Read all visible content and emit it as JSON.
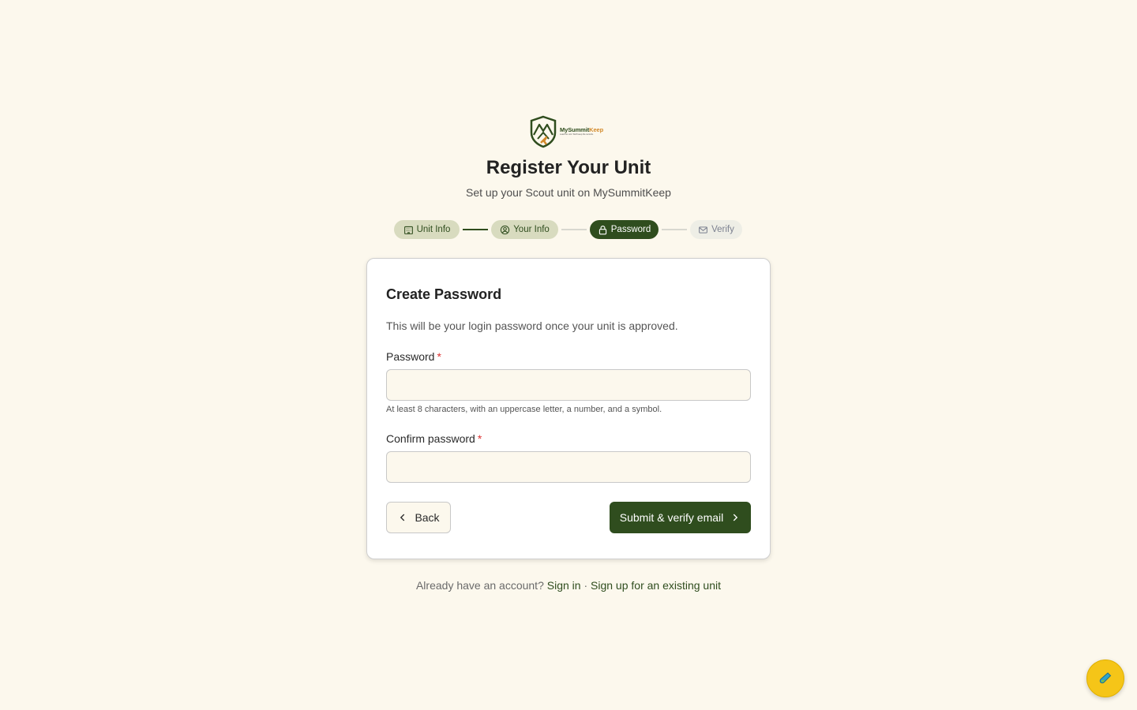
{
  "brand": {
    "name_part1": "MySummit",
    "name_part2": "Keep",
    "tagline": "Lead the unit. We'll keep the records."
  },
  "header": {
    "title": "Register Your Unit",
    "subtitle": "Set up your Scout unit on MySummitKeep"
  },
  "stepper": {
    "current_step": 3,
    "steps": [
      {
        "label": "Unit Info",
        "icon": "building-icon",
        "state": "done"
      },
      {
        "label": "Your Info",
        "icon": "user-circle-icon",
        "state": "done"
      },
      {
        "label": "Password",
        "icon": "lock-icon",
        "state": "active"
      },
      {
        "label": "Verify",
        "icon": "mail-icon",
        "state": "todo"
      }
    ]
  },
  "form": {
    "title": "Create Password",
    "description": "This will be your login password once your unit is approved.",
    "required_marker": "*",
    "password": {
      "label": "Password",
      "value": "",
      "placeholder": "",
      "hint": "At least 8 characters, with an uppercase letter, a number, and a symbol."
    },
    "confirm_password": {
      "label": "Confirm password",
      "value": "",
      "placeholder": ""
    },
    "back_button": {
      "label": "Back",
      "icon": "chevron-left-icon"
    },
    "submit_button": {
      "label": "Submit & verify email",
      "icon": "chevron-right-icon"
    }
  },
  "footer": {
    "prompt": "Already have an account?",
    "sign_in_link": "Sign in",
    "separator": "·",
    "existing_unit_link": "Sign up for an existing unit"
  },
  "fab": {
    "icon": "test-tube-icon"
  },
  "colors": {
    "background": "#fcf8ed",
    "primary": "#2f4d1e",
    "accent": "#d38a2b",
    "step_done_bg": "#d8dbbf",
    "step_todo_bg": "#eeeee6",
    "required": "#dd3333",
    "fab": "#f5c518"
  }
}
